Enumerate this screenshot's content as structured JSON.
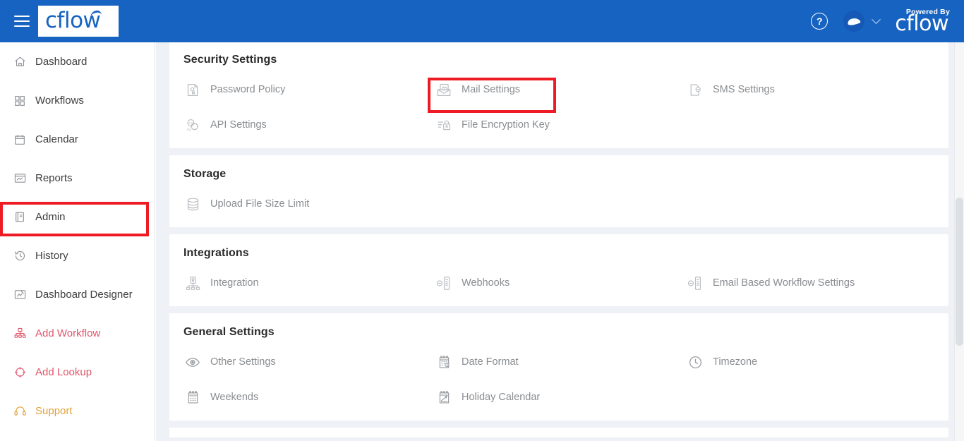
{
  "header": {
    "menu_icon": "hamburger-menu-icon",
    "logo_text": "cflow",
    "help_icon": "question-mark-help-icon",
    "avatar_icon": "user-avatar",
    "chevron_icon": "chevron-down-icon",
    "powered_by_label": "Powered By",
    "powered_logo_text": "cflow",
    "background_color": "#1763c1"
  },
  "sidebar": {
    "items": [
      {
        "label": "Dashboard",
        "icon": "home-icon",
        "style": "default"
      },
      {
        "label": "Workflows",
        "icon": "grid-squares-icon",
        "style": "default"
      },
      {
        "label": "Calendar",
        "icon": "calendar-icon",
        "style": "default"
      },
      {
        "label": "Reports",
        "icon": "report-chart-icon",
        "style": "default"
      },
      {
        "label": "Admin",
        "icon": "admin-book-icon",
        "style": "default",
        "highlighted": true
      },
      {
        "label": "History",
        "icon": "clock-history-icon",
        "style": "default"
      },
      {
        "label": "Dashboard Designer",
        "icon": "dashboard-designer-icon",
        "style": "default"
      },
      {
        "label": "Add Workflow",
        "icon": "add-workflow-icon",
        "style": "red"
      },
      {
        "label": "Add Lookup",
        "icon": "add-lookup-icon",
        "style": "red"
      },
      {
        "label": "Support",
        "icon": "headset-support-icon",
        "style": "orange"
      }
    ]
  },
  "highlight_color": "#ee1b24",
  "main": {
    "cards": [
      {
        "title": "Security Settings",
        "options": [
          {
            "label": "Password Policy",
            "icon": "password-policy-icon"
          },
          {
            "label": "Mail Settings",
            "icon": "mail-envelope-icon",
            "highlighted": true
          },
          {
            "label": "SMS Settings",
            "icon": "sms-phone-icon"
          },
          {
            "label": "API Settings",
            "icon": "api-gear-icon"
          },
          {
            "label": "File Encryption Key",
            "icon": "file-lock-icon"
          }
        ]
      },
      {
        "title": "Storage",
        "options": [
          {
            "label": "Upload File Size Limit",
            "icon": "database-icon"
          }
        ]
      },
      {
        "title": "Integrations",
        "options": [
          {
            "label": "Integration",
            "icon": "server-integration-icon"
          },
          {
            "label": "Webhooks",
            "icon": "webhook-icon"
          },
          {
            "label": "Email Based Workflow Settings",
            "icon": "webhook-icon"
          }
        ]
      },
      {
        "title": "General Settings",
        "options": [
          {
            "label": "Other Settings",
            "icon": "eye-icon"
          },
          {
            "label": "Date Format",
            "icon": "calendar-clock-icon"
          },
          {
            "label": "Timezone",
            "icon": "clock-icon"
          },
          {
            "label": "Weekends",
            "icon": "calendar-weekends-icon"
          },
          {
            "label": "Holiday Calendar",
            "icon": "holiday-calendar-icon"
          }
        ]
      }
    ]
  },
  "scrollbar": {
    "name": "vertical-scrollbar",
    "thumb_top_pct": 62
  }
}
